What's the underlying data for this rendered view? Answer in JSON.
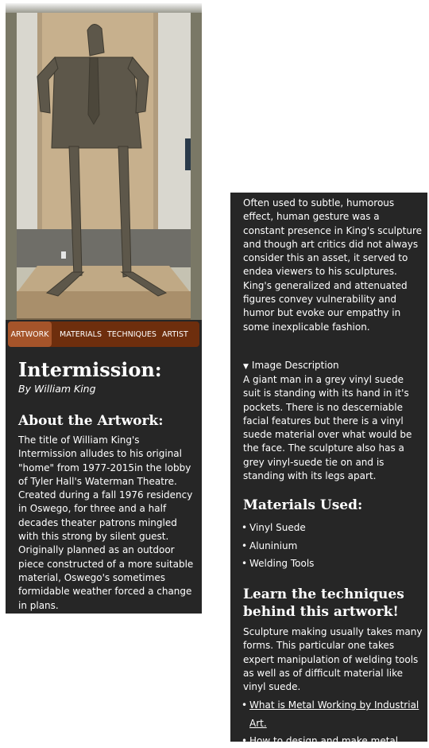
{
  "nav": {
    "tabs": [
      "ARTWORK",
      "MATERIALS",
      "TECHNIQUES",
      "ARTIST"
    ],
    "active": "ARTWORK"
  },
  "artwork": {
    "title": "Intermission:",
    "byline": "By William King",
    "image_icon": "sculpture-photo"
  },
  "about": {
    "heading": "About the Artwork:",
    "body": "The title of William King's Intermission alludes to his original \"home\" from 1977-2015in the lobby of Tyler Hall's Waterman Theatre. Created during a fall 1976 residency in Oswego, for three and a half decades theater patrons mingled with this strong by silent guest. Originally planned as an outdoor piece constructed of a more suitable material, Oswego's sometimes formidable weather forced a change in plans.",
    "continued": "Often used to subtle, humorous effect, human gesture was a constant presence in King's sculpture and though art critics did not always consider this an asset, it served to endea viewers to his sculptures. King's generalized and attenuated figures convey vulnerability and humor but evoke our empathy in some inexplicable fashion."
  },
  "image_description": {
    "summary": "Image Description",
    "body": "A giant man in a grey vinyl suede suit is standing with its hand in it's pockets. There is no descerniable facial features but there is a vinyl suede material over what would be the face. The sculpture also has a grey vinyl-suede tie on and is standing with its legs apart."
  },
  "materials": {
    "heading": "Materials Used:",
    "items": [
      "Vinyl Suede",
      "Aluninium",
      "Welding Tools"
    ]
  },
  "techniques": {
    "heading": "Learn the techniques behind this artwork!",
    "body": "Sculpture making usually takes many forms. This particular one takes expert manipulation of welding tools as well as of difficult material like vinyl suede.",
    "links": [
      "What is Metal Working by Industrial Art.",
      "How to design and make metal"
    ]
  },
  "colors": {
    "panel_bg": "#262626",
    "nav_bg": "#6e2e0d",
    "nav_active": "#a5542a"
  }
}
